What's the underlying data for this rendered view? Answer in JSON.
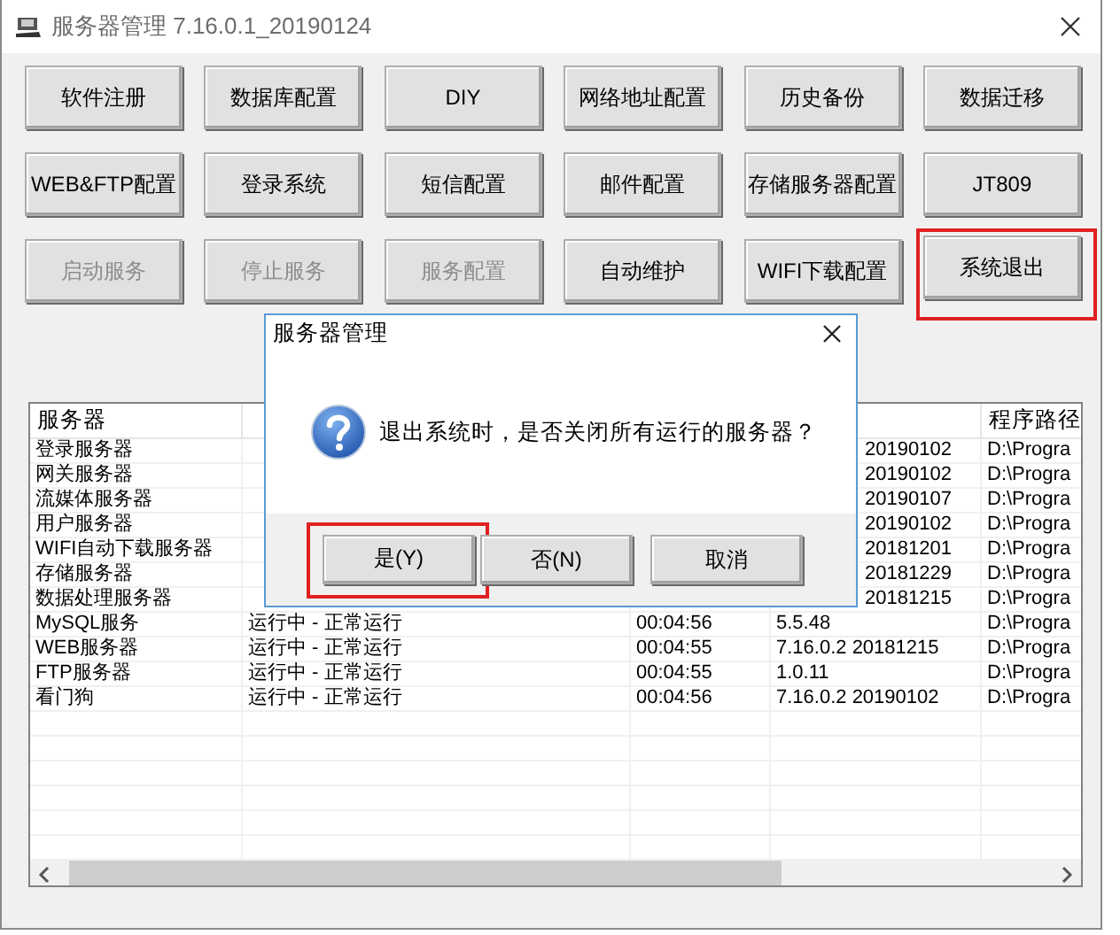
{
  "window": {
    "title": "服务器管理 7.16.0.1_20190124"
  },
  "button_rows": [
    [
      {
        "label": "软件注册",
        "disabled": false,
        "highlighted": false
      },
      {
        "label": "数据库配置",
        "disabled": false,
        "highlighted": false
      },
      {
        "label": "DIY",
        "disabled": false,
        "highlighted": false
      },
      {
        "label": "网络地址配置",
        "disabled": false,
        "highlighted": false
      },
      {
        "label": "历史备份",
        "disabled": false,
        "highlighted": false
      },
      {
        "label": "数据迁移",
        "disabled": false,
        "highlighted": false
      }
    ],
    [
      {
        "label": "WEB&FTP配置",
        "disabled": false,
        "highlighted": false
      },
      {
        "label": "登录系统",
        "disabled": false,
        "highlighted": false
      },
      {
        "label": "短信配置",
        "disabled": false,
        "highlighted": false
      },
      {
        "label": "邮件配置",
        "disabled": false,
        "highlighted": false
      },
      {
        "label": "存储服务器配置",
        "disabled": false,
        "highlighted": false
      },
      {
        "label": "JT809",
        "disabled": false,
        "highlighted": false
      }
    ],
    [
      {
        "label": "启动服务",
        "disabled": true,
        "highlighted": false
      },
      {
        "label": "停止服务",
        "disabled": true,
        "highlighted": false
      },
      {
        "label": "服务配置",
        "disabled": true,
        "highlighted": false
      },
      {
        "label": "自动维护",
        "disabled": false,
        "highlighted": false
      },
      {
        "label": "WIFI下载配置",
        "disabled": false,
        "highlighted": false
      },
      {
        "label": "系统退出",
        "disabled": false,
        "highlighted": true
      }
    ]
  ],
  "table": {
    "columns": [
      "服务器",
      null,
      null,
      null,
      "程序路径"
    ],
    "rows": [
      {
        "covered": true,
        "cells": [
          "登录服务器",
          null,
          null,
          "20190102",
          "D:\\Progra"
        ]
      },
      {
        "covered": true,
        "cells": [
          "网关服务器",
          null,
          null,
          "20190102",
          "D:\\Progra"
        ]
      },
      {
        "covered": true,
        "cells": [
          "流媒体服务器",
          null,
          null,
          "20190107",
          "D:\\Progra"
        ]
      },
      {
        "covered": true,
        "cells": [
          "用户服务器",
          null,
          null,
          "20190102",
          "D:\\Progra"
        ]
      },
      {
        "covered": true,
        "cells": [
          "WIFI自动下载服务器",
          null,
          null,
          "20181201",
          "D:\\Progra"
        ]
      },
      {
        "covered": true,
        "cells": [
          "存储服务器",
          null,
          null,
          "20181229",
          "D:\\Progra"
        ]
      },
      {
        "covered": true,
        "cells": [
          "数据处理服务器",
          null,
          null,
          "20181215",
          "D:\\Progra"
        ]
      },
      {
        "covered": false,
        "cells": [
          "MySQL服务",
          "运行中 - 正常运行",
          "00:04:56",
          "5.5.48",
          "D:\\Progra"
        ]
      },
      {
        "covered": false,
        "cells": [
          "WEB服务器",
          "运行中 - 正常运行",
          "00:04:55",
          "7.16.0.2 20181215",
          "D:\\Progra"
        ]
      },
      {
        "covered": false,
        "cells": [
          "FTP服务器",
          "运行中 - 正常运行",
          "00:04:55",
          "1.0.11",
          "D:\\Progra"
        ]
      },
      {
        "covered": false,
        "cells": [
          "看门狗",
          "运行中 - 正常运行",
          "00:04:56",
          "7.16.0.2 20190102",
          "D:\\Progra"
        ]
      }
    ]
  },
  "dialog": {
    "title": "服务器管理",
    "message": "退出系统时，是否关闭所有运行的服务器？",
    "buttons": [
      {
        "label": "是(Y)",
        "highlighted": true
      },
      {
        "label": "否(N)",
        "highlighted": false
      },
      {
        "label": "取消",
        "highlighted": false
      }
    ]
  }
}
